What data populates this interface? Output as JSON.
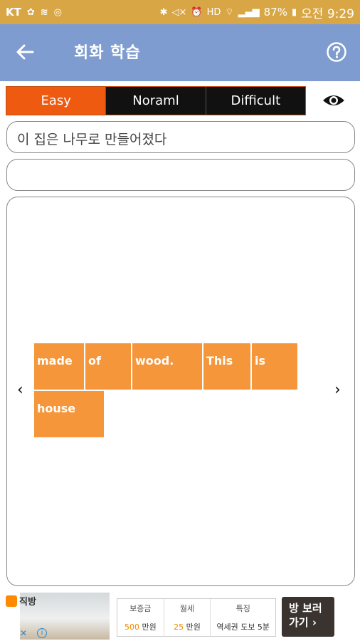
{
  "status_bar": {
    "carrier": "KT",
    "battery": "87%",
    "time": "오전 9:29"
  },
  "app_bar": {
    "title": "회화 학습"
  },
  "level_tabs": [
    "Easy",
    "Noraml",
    "Difficult"
  ],
  "active_level": "Easy",
  "sentence": "이 집은 나무로 만들어졌다",
  "answer": "",
  "word_tiles": [
    "made",
    "of",
    "wood.",
    "This",
    "is",
    "house"
  ],
  "nav": {
    "prev": "‹",
    "next": "›"
  },
  "ad": {
    "brand": "직방",
    "close": "✕",
    "info": "i",
    "columns": [
      {
        "header": "보증금",
        "value_num": "500",
        "value_unit": " 만원"
      },
      {
        "header": "월세",
        "value_num": "25",
        "value_unit": " 만원"
      },
      {
        "header": "특징",
        "value_num": "",
        "value_unit": "역세권 도보 5분"
      }
    ],
    "cta_line1": "방 보러",
    "cta_line2": "가기 ›"
  }
}
